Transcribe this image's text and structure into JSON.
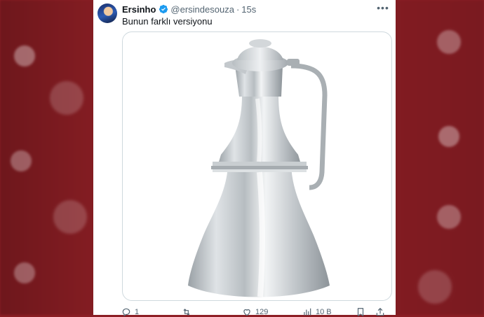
{
  "tweet": {
    "author_name": "Ersinho",
    "handle": "@ersindesouza",
    "separator": "·",
    "time": "15s",
    "text": "Bunun farklı versiyonu",
    "image_subject": "silver-pitcher-icon",
    "more_icon": "more-dots-icon",
    "actions": {
      "replies": "1",
      "reposts": "",
      "likes": "129",
      "views": "10 B"
    },
    "colors": {
      "verified": "#1d9bf0",
      "muted": "#536471",
      "text": "#0f1419",
      "backdrop": "#8e1f25"
    }
  }
}
